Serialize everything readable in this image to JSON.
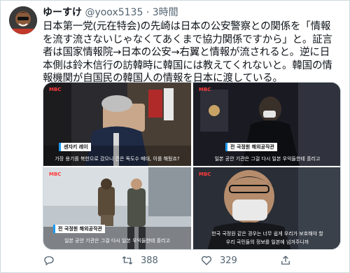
{
  "tweet": {
    "display_name": "ゆーすけ",
    "handle": "@yoox5135",
    "separator": "·",
    "time": "3時間",
    "text": "日本第一党(元在特会)の先崎は日本の公安警察との関係を「情報を流す流さないじゃなくてあくまで協力関係ですから」と。証言者は国家情報院→日本の公安→右翼と情報が流されると。逆に日本側は鈴木信行の訪韓時に韓国には教えてくれないと。韓国の情報機関が自国民の韓国人の情報を日本に渡している。"
  },
  "media": {
    "tile1": {
      "logo": "MBC",
      "name_tag": "센자키 레이",
      "caption": "가장 용기를 북한으로 갔으니 건은 독도수 배대, 이를 해뒀죠?"
    },
    "tile2": {
      "logo": "MBC",
      "name_tag": "전 국정원 해외공작관",
      "caption": "일본 공안 기관은 그걸 다시 일본 우익들한테 흘리고"
    },
    "tile3": {
      "logo": "MBC",
      "name_tag": "전 국정원 해외공작관",
      "caption": "일본 공안 기관은 그걸 다시 일본 우익들한테 흘리고"
    },
    "tile4": {
      "logo": "MBC",
      "caption_line1": "한국 국정원 같은 경우는 너무 쉽게 우리가 보호해야 할",
      "caption_line2": "우리 국민들의 정보를 일본에 넘겨주니까"
    }
  },
  "actions": {
    "reply_count": "",
    "retweet_count": "388",
    "like_count": "329"
  },
  "colors": {
    "accent": "#1d9bf0",
    "text": "#0f1419",
    "secondary": "#536471",
    "border": "#cfd9de"
  }
}
